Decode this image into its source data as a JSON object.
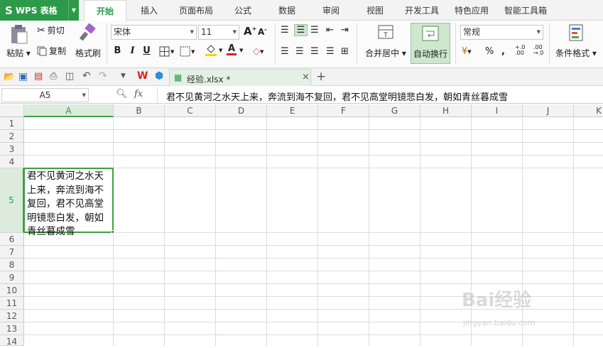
{
  "app": {
    "logo_text": "WPS 表格"
  },
  "menu_tabs": [
    {
      "label": "开始",
      "active": true
    },
    {
      "label": "插入"
    },
    {
      "label": "页面布局"
    },
    {
      "label": "公式"
    },
    {
      "label": "数据"
    },
    {
      "label": "审阅"
    },
    {
      "label": "视图"
    },
    {
      "label": "开发工具"
    },
    {
      "label": "特色应用"
    },
    {
      "label": "智能工具箱"
    }
  ],
  "ribbon": {
    "paste_label": "粘贴",
    "cut_label": "剪切",
    "copy_label": "复制",
    "format_painter_label": "格式刷",
    "font_name": "宋体",
    "font_size": "11",
    "merge_center_label": "合并居中",
    "wrap_text_label": "自动换行",
    "number_format": "常规",
    "cond_format_label": "条件格式",
    "bold": "B",
    "italic": "I",
    "underline": "U",
    "font_color_letter": "A",
    "font_color": "#e02020",
    "fill_color": "#f5d800"
  },
  "document_tab": {
    "title": "经验.xlsx *"
  },
  "formula_bar": {
    "cell_ref": "A5",
    "fx": "fx",
    "content": "君不见黄河之水天上来，奔流到海不复回，君不见高堂明镜悲白发，朝如青丝暮成雪"
  },
  "sheet": {
    "columns": [
      "A",
      "B",
      "C",
      "D",
      "E",
      "F",
      "G",
      "H",
      "I",
      "J",
      "K"
    ],
    "rows": [
      "1",
      "2",
      "3",
      "4",
      "5",
      "6",
      "7",
      "8",
      "9",
      "10",
      "11",
      "12",
      "13",
      "14"
    ],
    "cell_A5": "君不见黄河之水天上来，奔流到海不复回，君不见高堂明镜悲白发，朝如青丝暮成雪",
    "selected_col": "A",
    "selected_row": "5"
  },
  "watermark": {
    "line1": "Bai经验",
    "line2": "jingyan.baidu.com"
  },
  "colors": {
    "accent": "#2c9a48",
    "selection": "#3f9e43"
  }
}
